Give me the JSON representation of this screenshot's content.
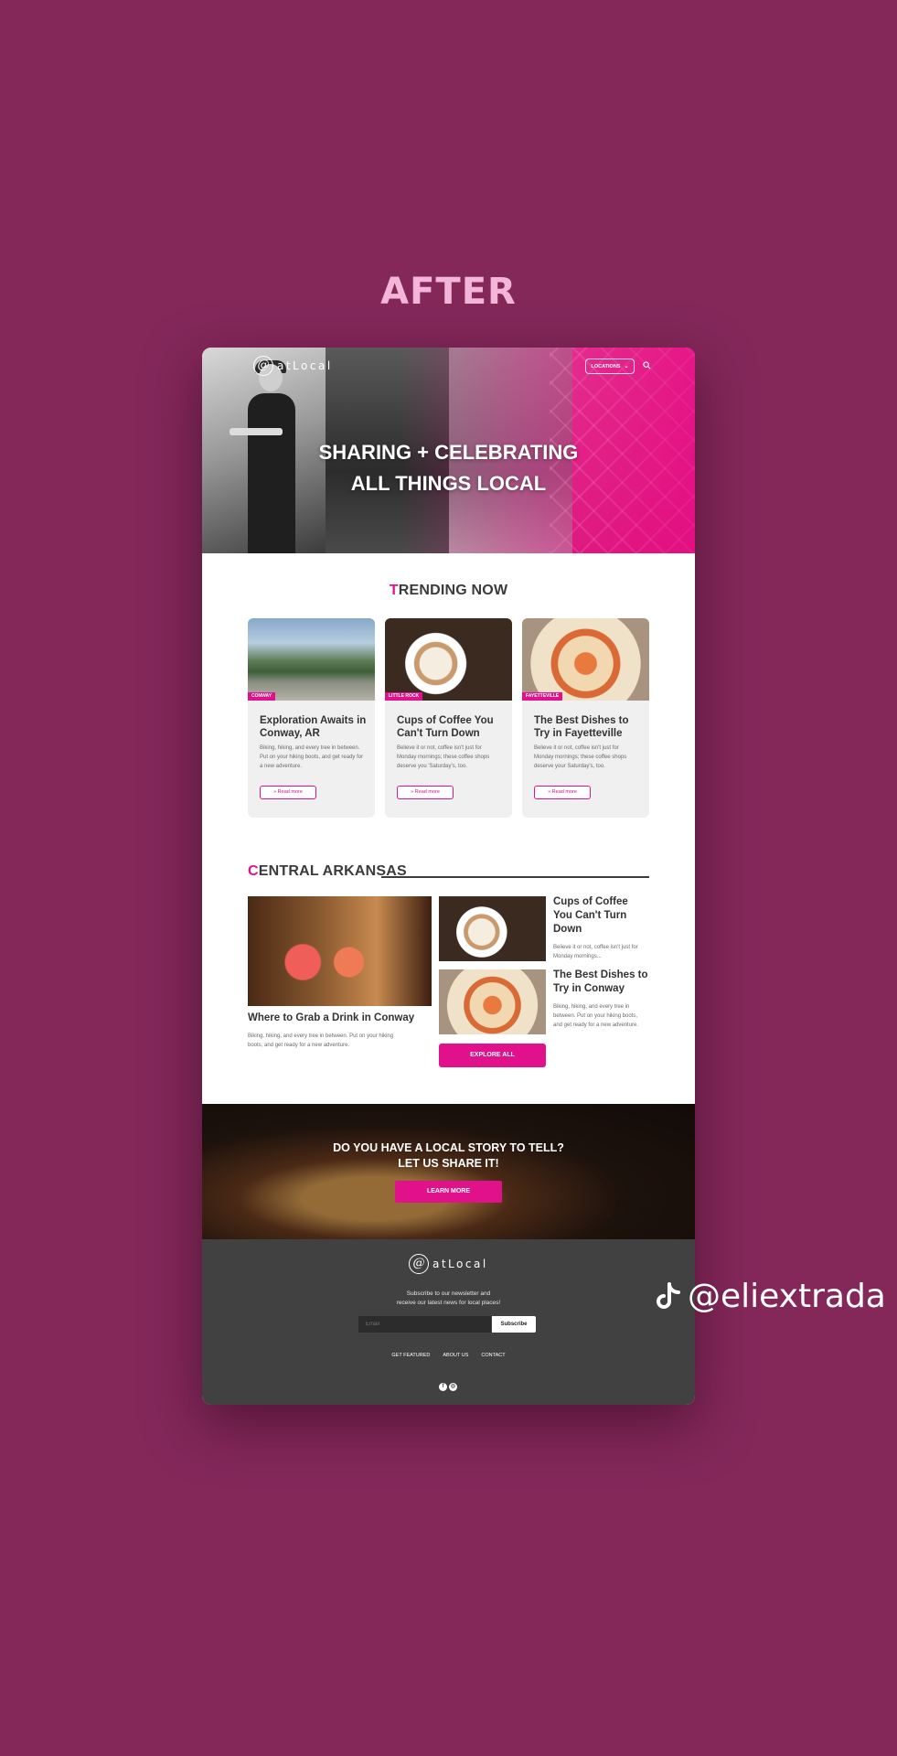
{
  "heading": "AFTER",
  "colors": {
    "background": "#84285a",
    "accent": "#e0118a",
    "heading": "#f3b6d8",
    "footer": "#414141"
  },
  "site": {
    "logo_mark": "@",
    "logo_text": "atLocal",
    "nav": {
      "locations_label": "LOCATIONS",
      "chevron_icon": "chevron-down-icon",
      "search_icon": "search-icon"
    },
    "hero": {
      "title_line1": "SHARING + CELEBRATING",
      "title_line2": "ALL THINGS LOCAL"
    },
    "trending": {
      "title_first": "T",
      "title_rest": "RENDING NOW",
      "cards": [
        {
          "tag": "CONWAY",
          "title": "Exploration Awaits in Conway, AR",
          "text": "Biking, hiking, and every tree in between. Put on your hiking boots, and get ready for a new adventure.",
          "button": "» Read more"
        },
        {
          "tag": "LITTLE ROCK",
          "title": "Cups of Coffee You Can't Turn Down",
          "text": "Believe it or not, coffee isn't just for Monday mornings; these coffee shops deserve you 'Saturday's, too.",
          "button": "» Read more"
        },
        {
          "tag": "FAYETTEVILLE",
          "title": "The Best Dishes to Try in Fayetteville",
          "text": "Believe it or not, coffee isn't just for Monday mornings; these coffee shops deserve your Saturday's, too.",
          "button": "» Read more"
        }
      ]
    },
    "central": {
      "title_first": "C",
      "title_rest": "ENTRAL ARKANSAS",
      "main": {
        "title": "Where to Grab a Drink in Conway",
        "text": "Biking, hiking, and every tree in between. Put on your hiking boots, and get ready for a new adventure."
      },
      "side": [
        {
          "title": "Cups of Coffee You Can't Turn Down",
          "text": "Believe it or not, coffee isn't just for Monday mornings..."
        },
        {
          "title": "The Best Dishes to Try in Conway",
          "text": "Biking, hiking, and every tree in between. Put on your hiking boots, and get ready for a new adventure."
        }
      ],
      "explore_label": "EXPLORE ALL"
    },
    "banner": {
      "line1": "DO YOU HAVE A LOCAL STORY TO TELL?",
      "line2": "LET US SHARE IT!",
      "button": "LEARN MORE"
    },
    "footer": {
      "text_line1": "Subscribe to our newsletter and",
      "text_line2": "receive our latest news for local places!",
      "email_placeholder": "Email",
      "subscribe_label": "Subscribe",
      "links": [
        "GET FEATURED",
        "ABOUT US",
        "CONTACT"
      ],
      "social_icons": [
        "facebook-icon",
        "instagram-icon"
      ]
    }
  },
  "watermark": {
    "icon": "tiktok-icon",
    "handle": "@eliextrada"
  }
}
